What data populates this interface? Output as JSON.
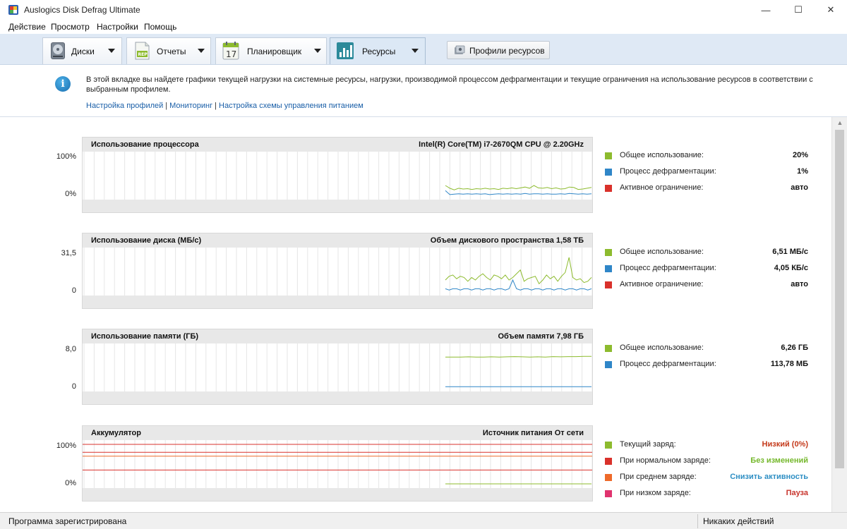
{
  "window": {
    "title": "Auslogics Disk Defrag Ultimate",
    "controls": {
      "minimize": "—",
      "maximize": "☐",
      "close": "✕"
    }
  },
  "menu": [
    "Действие",
    "Просмотр",
    "Настройки",
    "Помощь"
  ],
  "tabs": [
    {
      "label": "Диски",
      "icon": "disk-icon",
      "active": false
    },
    {
      "label": "Отчеты",
      "icon": "report-icon",
      "active": false
    },
    {
      "label": "Планировщик",
      "icon": "calendar-icon",
      "calendar_day": "17",
      "active": false
    },
    {
      "label": "Ресурсы",
      "icon": "resources-chart-icon",
      "active": true
    }
  ],
  "profile_button": {
    "label": "Профили ресурсов",
    "icon": "profiles-icon"
  },
  "info": {
    "text": "В этой вкладке вы найдете графики текущей нагрузки на системные ресурсы, нагрузки, производимой процессом дефрагментации и текущие ограничения на использование ресурсов в соответствии с выбранным профилем.",
    "links": [
      "Настройка профилей",
      "Мониторинг",
      "Настройка схемы управления питанием"
    ],
    "separator": "|"
  },
  "colors": {
    "green": "#8dbb2e",
    "blue": "#2f86c8",
    "red": "#d9312b",
    "orange": "#ee6a2a",
    "pink": "#e0336e",
    "low_red": "#c43a1b",
    "nochange_green": "#75b82c",
    "reduce_blue": "#2e8fc4",
    "pause_red": "#c8352d"
  },
  "panels": [
    {
      "id": "cpu",
      "title": "Использование процессора",
      "right": "Intel(R) Core(TM) i7-2670QM CPU @ 2.20GHz",
      "ymax_label": "100%",
      "ymin_label": "0%",
      "ymax": 100,
      "legend": [
        {
          "label": "Общее использование:",
          "value": "20%",
          "color": "#8dbb2e"
        },
        {
          "label": "Процесс дефрагментации:",
          "value": "1%",
          "color": "#2f86c8"
        },
        {
          "label": "Активное ограничение:",
          "value": "авто",
          "color": "#d9312b"
        }
      ],
      "series": [
        {
          "color": "#8dbb2e",
          "values": [
            25,
            18,
            14,
            18,
            16,
            17,
            15,
            17,
            16,
            18,
            16,
            17,
            15,
            18,
            17,
            19,
            17,
            19,
            21,
            18,
            25,
            19,
            18,
            20,
            17,
            19,
            16,
            17,
            21,
            20,
            15,
            16,
            18,
            20
          ]
        },
        {
          "color": "#2f86c8",
          "values": [
            12,
            2,
            3,
            4,
            3,
            4,
            3,
            4,
            3,
            4,
            2,
            3,
            4,
            3,
            4,
            3,
            4,
            3,
            5,
            3,
            4,
            4,
            3,
            4,
            3,
            3,
            4,
            3,
            5,
            4,
            3,
            4,
            3,
            4
          ]
        }
      ]
    },
    {
      "id": "disk",
      "title": "Использование диска (МБ/с)",
      "right": "Объем дискового пространства 1,58 ТБ",
      "ymax_label": "31,5",
      "ymin_label": "0",
      "ymax": 31.5,
      "legend": [
        {
          "label": "Общее использование:",
          "value": "6,51 МБ/с",
          "color": "#8dbb2e"
        },
        {
          "label": "Процесс дефрагментации:",
          "value": "4,05 КБ/с",
          "color": "#2f86c8"
        },
        {
          "label": "Активное ограничение:",
          "value": "авто",
          "color": "#d9312b"
        }
      ],
      "series": [
        {
          "color": "#8dbb2e",
          "values": [
            9,
            12,
            13,
            10,
            12,
            11,
            8,
            11,
            9,
            12,
            14,
            11,
            9,
            13,
            12,
            10,
            13,
            9,
            11,
            14,
            17,
            8,
            10,
            11,
            12,
            6,
            9,
            13,
            10,
            12,
            8,
            12,
            15,
            27,
            11,
            9,
            10,
            7,
            8,
            11
          ]
        },
        {
          "color": "#2f86c8",
          "values": [
            2,
            1,
            2,
            2,
            1,
            2,
            2,
            1,
            2,
            2,
            1,
            2,
            2,
            1,
            2,
            2,
            1,
            2,
            9,
            2,
            1,
            2,
            2,
            1,
            2,
            2,
            1,
            2,
            2,
            1,
            2,
            2,
            1,
            2,
            2,
            1,
            2,
            2,
            1,
            2
          ]
        }
      ]
    },
    {
      "id": "memory",
      "title": "Использование памяти (ГБ)",
      "right": "Объем памяти 7,98 ГБ",
      "ymax_label": "8,0",
      "ymin_label": "0",
      "ymax": 8.0,
      "legend": [
        {
          "label": "Общее использование:",
          "value": "6,26 ГБ",
          "color": "#8dbb2e"
        },
        {
          "label": "Процесс дефрагментации:",
          "value": "113,78 МБ",
          "color": "#2f86c8"
        }
      ],
      "series": [
        {
          "color": "#8dbb2e",
          "values": [
            6.1,
            6.1,
            6.1,
            6.15,
            6.1,
            6.1,
            6.15,
            6.1,
            6.15,
            6.2,
            6.15,
            6.1,
            6.15,
            6.1,
            6.2,
            6.15,
            6.2,
            6.2,
            6.25,
            6.26
          ]
        },
        {
          "color": "#2f86c8",
          "values": [
            0.11,
            0.11,
            0.11,
            0.11,
            0.11,
            0.11,
            0.11,
            0.11,
            0.11,
            0.11,
            0.11,
            0.11,
            0.11,
            0.11,
            0.11,
            0.11,
            0.11,
            0.11,
            0.11,
            0.11
          ]
        }
      ]
    },
    {
      "id": "battery",
      "title": "Аккумулятор",
      "right": "Источник питания От сети",
      "ymax_label": "100%",
      "ymin_label": "0%",
      "ymax": 100,
      "hlines": [
        {
          "color": "#d9312b",
          "value": 100
        },
        {
          "color": "#d9312b",
          "value": 80
        },
        {
          "color": "#ee6a2a",
          "value": 70
        },
        {
          "color": "#d9312b",
          "value": 35
        }
      ],
      "legend": [
        {
          "label": "Текущий заряд:",
          "value": "Низкий (0%)",
          "color": "#8dbb2e",
          "value_color": "#c43a1b"
        },
        {
          "label": "При нормальном заряде:",
          "value": "Без изменений",
          "color": "#d9312b",
          "value_color": "#75b82c"
        },
        {
          "label": "При среднем заряде:",
          "value": "Снизить активность",
          "color": "#ee6a2a",
          "value_color": "#2e8fc4"
        },
        {
          "label": "При низком заряде:",
          "value": "Пауза",
          "color": "#e0336e",
          "value_color": "#c8352d"
        }
      ],
      "series": [
        {
          "color": "#8dbb2e",
          "values": [
            0,
            0,
            0,
            0,
            0,
            0,
            0,
            0,
            0,
            0,
            0,
            0,
            0,
            0,
            0,
            0,
            0,
            0,
            0,
            0
          ]
        }
      ]
    }
  ],
  "status": {
    "left": "Программа зарегистрирована",
    "right": "Никаких действий"
  }
}
